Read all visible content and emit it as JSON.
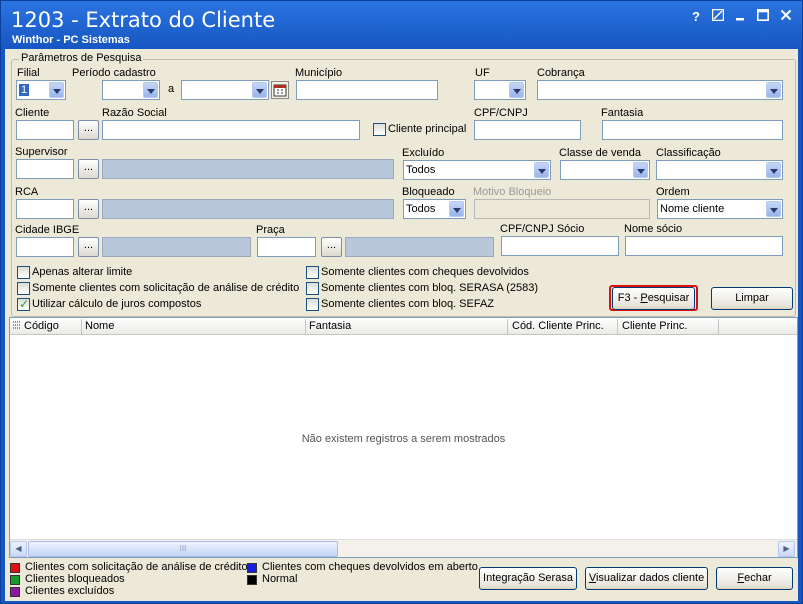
{
  "window": {
    "title": "1203 - Extrato do Cliente",
    "subtitle": "Winthor - PC Sistemas",
    "help_icon": "?",
    "controls": [
      "help-icon",
      "restore-icon",
      "minimize-icon",
      "maximize-icon",
      "close-icon"
    ]
  },
  "params": {
    "legend": "Parâmetros de Pesquisa",
    "filial_label": "Filial",
    "filial_value": "1",
    "periodo_label": "Período cadastro",
    "periodo_sep": "a",
    "municipio_label": "Município",
    "uf_label": "UF",
    "cobranca_label": "Cobrança",
    "cliente_label": "Cliente",
    "razao_label": "Razão Social",
    "cliente_principal_label": "Cliente principal",
    "cpf_label": "CPF/CNPJ",
    "fantasia_label": "Fantasia",
    "supervisor_label": "Supervisor",
    "excluido_label": "Excluído",
    "excluido_value": "Todos",
    "classe_label": "Classe de venda",
    "classificacao_label": "Classificação",
    "rca_label": "RCA",
    "bloqueado_label": "Bloqueado",
    "bloqueado_value": "Todos",
    "motivo_label": "Motivo Bloqueio",
    "ordem_label": "Ordem",
    "ordem_value": "Nome cliente",
    "cidade_label": "Cidade IBGE",
    "praca_label": "Praça",
    "cpf_socio_label": "CPF/CNPJ Sócio",
    "nome_socio_label": "Nome sócio",
    "dots": "..."
  },
  "options": {
    "apenas_alterar": "Apenas alterar limite",
    "somente_solicitacao": "Somente clientes com solicitação de análise de crédito",
    "juros_compostos": "Utilizar cálculo de juros compostos",
    "cheques_devolvidos": "Somente clientes com cheques devolvidos",
    "bloq_serasa": "Somente clientes com bloq. SERASA (2583)",
    "bloq_sefaz": "Somente clientes com bloq. SEFAZ"
  },
  "buttons": {
    "pesquisar_pre": "F3 - ",
    "pesquisar_u": "P",
    "pesquisar_post": "esquisar",
    "limpar": "Limpar",
    "integracao": "Integração Serasa",
    "visualizar_u": "V",
    "visualizar_post": "isualizar dados cliente",
    "fechar_u": "F",
    "fechar_post": "echar"
  },
  "grid": {
    "columns": [
      "Código",
      "Nome",
      "Fantasia",
      "Cód. Cliente Princ.",
      "Cliente Princ."
    ],
    "empty_message": "Não existem registros a serem mostrados",
    "scroll_thumb": "III"
  },
  "legend": {
    "items": [
      {
        "label": "Clientes com solicitação de análise de crédito",
        "color": "#e01010"
      },
      {
        "label": "Clientes bloqueados",
        "color": "#1a9a2a"
      },
      {
        "label": "Clientes excluídos",
        "color": "#8a1aa0"
      },
      {
        "label": "Clientes com cheques devolvidos em aberto",
        "color": "#1020e0"
      },
      {
        "label": "Normal",
        "color": "#000000"
      }
    ]
  },
  "colors": {
    "highlight": "#e01010",
    "titlebar": "#1656c2"
  }
}
